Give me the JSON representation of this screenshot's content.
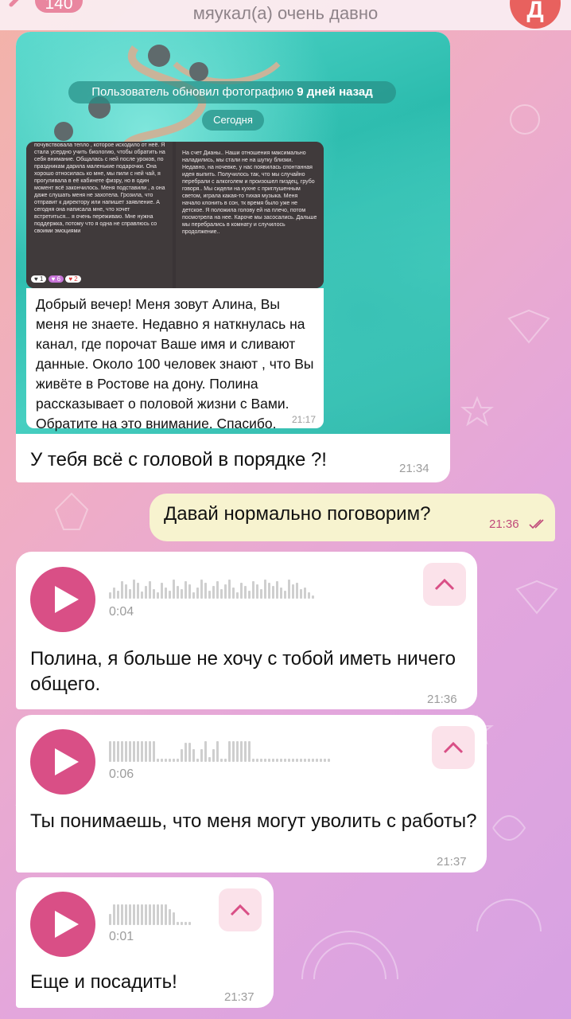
{
  "header": {
    "unread_badge": "140",
    "status": "мяукал(а) очень давно",
    "avatar_letter": "Д"
  },
  "photo_message": {
    "service_text": "Пользователь обновил фотографию",
    "service_time_bold": "9 дней назад",
    "date_pill": "Сегодня",
    "screenshot_left_text": "почувствовала тепло , которое исходило от неё. Я стала усердно учить биологию, чтобы обратить на себя внимание. Общалась с ней после уроков, по праздникам дарила маленькие подарочки. Она хорошо относилась ко мне, мы пили с ней чай, я прогуливала в её кабинете физру, но в один момент всё закончилось. Меня подставили , а она даже слушать меня не захотела. Грозила, что отправит к директору или напишет заявление. А сегодня она написала мне, что хочет встретиться... я очень переживаю. Мне нужна поддержка, потому что я одна не справлюсь со своими эмоциями",
    "screenshot_right_text": "На счет Дианы.. Наши отношения максимально наладились, мы стали не на шутку близки. Недавно, на ночевке, у нас появилась спонтанная идея выпить. Получилось так, что мы случайно перебрали с алкоголем и произошел пиздец, грубо говоря.. Мы сидели на кухне с приглушенным светом, играла какая-то тихая музыка. Меня начало клонить в сон, тк время было уже не детское. Я положила голову ей на плечо, потом посмотрела на нее. Кароче мы засосались. Дальше мы перебрались в комнату и случилось продолжение..",
    "inner_text": "Добрый вечер! Меня зовут Алина, Вы меня не знаете. Недавно я наткнулась на канал, где порочат Ваше имя и сливают данные. Около 100 человек знают , что Вы живёте в Ростове на дону. Полина рассказывает о половой жизни с Вами. Обратите на это внимание. Спасибо.",
    "inner_time": "21:17",
    "caption": "У тебя всё с головой в порядке ?!",
    "time": "21:34"
  },
  "sent_message": {
    "text": "Давай нормально поговорим?",
    "time": "21:36"
  },
  "voice_messages": [
    {
      "duration": "0:04",
      "transcript": "Полина, я больше не хочу с тобой иметь ничего общего.",
      "time": "21:36",
      "wave": [
        8,
        14,
        10,
        22,
        18,
        12,
        24,
        20,
        9,
        16,
        22,
        12,
        8,
        20,
        14,
        10,
        24,
        16,
        12,
        22,
        18,
        8,
        14,
        24,
        20,
        10,
        16,
        22,
        12,
        18,
        24,
        14,
        8,
        20,
        16,
        10,
        22,
        18,
        12,
        24,
        20,
        16,
        22,
        14,
        10,
        24,
        18,
        20,
        12,
        14,
        8,
        4
      ]
    },
    {
      "duration": "0:06",
      "transcript": "Ты понимаешь, что меня могут уволить с работы?",
      "time": "21:37",
      "wave": [
        26,
        26,
        26,
        26,
        26,
        26,
        26,
        26,
        26,
        26,
        26,
        26,
        4,
        4,
        4,
        4,
        4,
        4,
        16,
        24,
        24,
        16,
        4,
        16,
        26,
        6,
        16,
        26,
        4,
        4,
        26,
        26,
        26,
        26,
        26,
        26,
        4,
        4,
        4,
        4,
        4,
        4,
        4,
        4,
        4,
        4,
        4,
        4,
        4,
        4,
        4,
        4,
        4,
        4,
        4,
        4
      ]
    },
    {
      "duration": "0:01",
      "transcript": "Еще и посадить!",
      "time": "21:37",
      "wave": [
        14,
        26,
        26,
        26,
        26,
        26,
        26,
        26,
        26,
        26,
        26,
        26,
        26,
        26,
        26,
        20,
        16,
        4,
        4,
        4,
        4
      ]
    }
  ]
}
